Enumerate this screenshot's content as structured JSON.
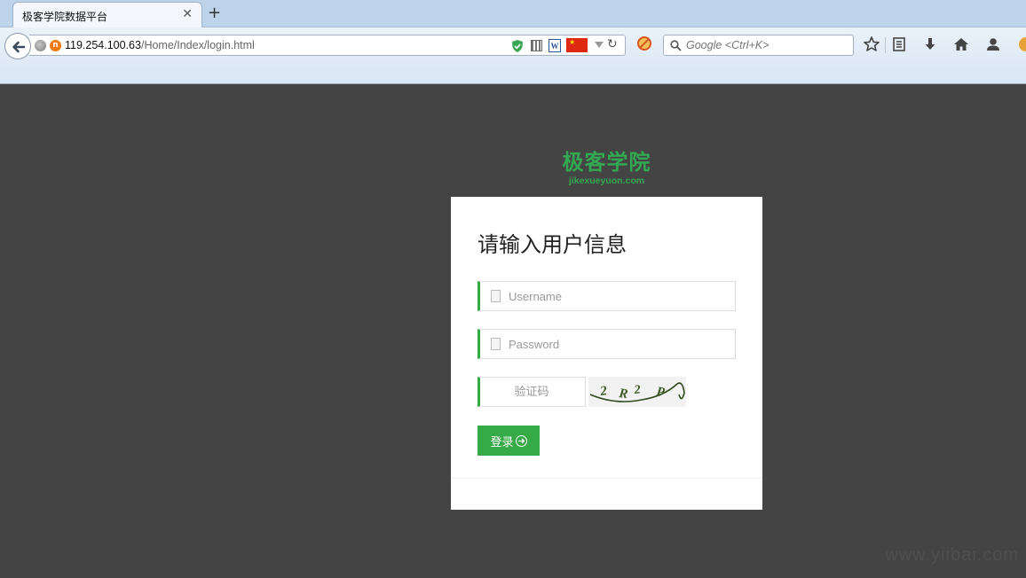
{
  "browser": {
    "tab_title": "极客学院数据平台",
    "tab_close": "✕",
    "new_tab": "+",
    "url_host": "119.254.100.63",
    "url_path": "/Home/Index/login.html",
    "search_placeholder": "Google <Ctrl+K>",
    "icons": [
      "back-icon",
      "globe-icon",
      "site-icon",
      "shield-icon",
      "qr-code-icon",
      "word-icon",
      "china-flag-icon",
      "dropdown-icon",
      "reload-icon",
      "adblock-icon",
      "search-icon",
      "bookmark-star-icon",
      "reading-list-icon",
      "download-icon",
      "home-icon",
      "user-icon"
    ]
  },
  "logo": {
    "name": "极客学院",
    "domain": "jikexueyuon.com",
    "color": "#32a852"
  },
  "login": {
    "title": "请输入用户信息",
    "username_placeholder": "Username",
    "password_placeholder": "Password",
    "captcha_placeholder": "验证码",
    "captcha_text": "2R2P",
    "submit_label": "登录",
    "accent_color": "#35aa47"
  },
  "watermark": "www.yiibai.com"
}
